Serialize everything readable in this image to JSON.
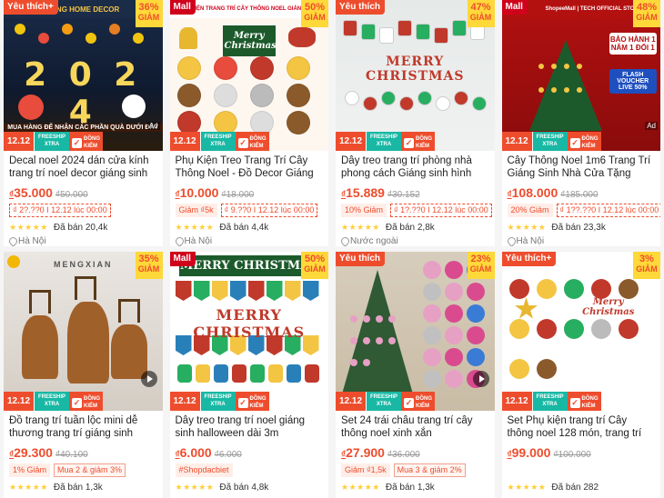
{
  "common": {
    "promo_date": "12.12",
    "free_ship_top": "FREESHIP",
    "free_ship_bottom": "XTRA",
    "guarantee_top": "ĐỒNG",
    "guarantee_bottom": "KIỂM",
    "discount_word": "GIẢM",
    "currency": "₫",
    "ad": "Ad",
    "stars": "★★★★★"
  },
  "products": [
    {
      "label": "Yêu thích+",
      "label_type": "fav",
      "discount": "36%",
      "shop_banner": "TUNG HOME DECOR",
      "thumb_text": "2 0 2 4",
      "thumb_sub": "MUA HÀNG ĐỂ NHẬN CÁC PHẦN QUÀ DƯỚI ĐÂY",
      "title": "Decal noel 2024 dán cửa kính trang trí noel decor giáng sinh ...",
      "price": "35.000",
      "original_price": "₫50.000",
      "tags": [
        "₫ 2?.??0 I 12.12 lúc 00:00"
      ],
      "sold": "Đã bán 20,4k",
      "location": "Hà Nội",
      "has_ad": true,
      "has_play": false
    },
    {
      "label": "Mall",
      "label_type": "mall",
      "discount": "50%",
      "shop_banner": "PHỤ KIỆN TRANG TRÍ CÂY THÔNG NOEL GIÁNG SINH",
      "thumb_text": "Merry Christmas",
      "thumb_sub": "",
      "title": "Phụ Kiện Treo Trang Trí Cây Thông Noel - Đồ Decor Giáng ...",
      "price": "10.000",
      "original_price": "₫18.000",
      "tags": [
        "Giảm ₫5k",
        "₫ 9.??0 I 12.12 lúc 00:00"
      ],
      "sold": "Đã bán 4,4k",
      "location": "Hà Nội",
      "has_ad": false,
      "has_play": false
    },
    {
      "label": "Yêu thích",
      "label_type": "fav",
      "discount": "47%",
      "shop_banner": "",
      "thumb_text": "MERRY CHRISTMAS",
      "thumb_sub": "",
      "title": "Dây treo trang trí phòng nhà phong cách Giáng sinh hình ôn...",
      "price": "15.889",
      "original_price": "₫30.152",
      "tags": [
        "10% Giảm",
        "₫ 1?.??0 I 12.12 lúc 00:00"
      ],
      "sold": "Đã bán 2,8k",
      "location": "Nước ngoài",
      "has_ad": false,
      "has_play": false
    },
    {
      "label": "Mall",
      "label_type": "mall",
      "discount": "48%",
      "shop_banner": "ShopeeMall | TECH OFFICIAL STORE",
      "thumb_text": "BẢO HÀNH 1 NĂM 1 ĐỔI 1",
      "thumb_sub": "FLASH VOUCHER LIVE 50%",
      "title": "Cây Thông Noel 1m6 Trang Trí Giáng Sinh Nhà Cửa Tặng Kèm ...",
      "price": "108.000",
      "original_price": "₫185.000",
      "tags": [
        "20% Giảm",
        "₫ 1??.??0 I 12.12 lúc 00:00"
      ],
      "sold": "Đã bán 23,3k",
      "location": "Hà Nội",
      "has_ad": true,
      "has_play": false
    },
    {
      "label": "",
      "label_type": "",
      "discount": "35%",
      "shop_banner": "MENGXIAN",
      "thumb_text": "",
      "thumb_sub": "",
      "title": "Đồ trang trí tuần lộc mini dễ thương trang trí giáng sinh sán...",
      "price": "29.300",
      "original_price": "₫40.100",
      "tags": [
        "1% Giảm",
        "Mua 2 & giảm 3%"
      ],
      "sold": "Đã bán 1,3k",
      "location": "",
      "has_ad": false,
      "has_play": true
    },
    {
      "label": "Mall",
      "label_type": "mall",
      "discount": "50%",
      "shop_banner": "",
      "thumb_text": "MERRY CHRISTMAS",
      "thumb_sub": "",
      "title": "Dây treo trang trí noel giáng sinh halloween dài 3m",
      "price": "6.000",
      "original_price": "₫6.000",
      "tags": [
        "#Shopdacbiet"
      ],
      "sold": "Đã bán 4,8k",
      "location": "",
      "has_ad": false,
      "has_play": false
    },
    {
      "label": "Yêu thích",
      "label_type": "fav",
      "discount": "23%",
      "shop_banner": "",
      "thumb_text": "",
      "thumb_sub": "",
      "title": "Set 24 trái châu trang trí cây thông noel xinh xắn",
      "price": "27.900",
      "original_price": "₫36.000",
      "tags": [
        "Giảm ₫1,5k",
        "Mua 3 & giảm 2%"
      ],
      "sold": "Đã bán 1,3k",
      "location": "",
      "has_ad": false,
      "has_play": true
    },
    {
      "label": "Yêu thích+",
      "label_type": "fav",
      "discount": "3%",
      "shop_banner": "",
      "thumb_text": "Merry Christmas",
      "thumb_sub": "",
      "title": "Set Phụ kiện trang trí Cây thông noel 128 món, trang trí giáng ...",
      "price": "99.000",
      "original_price": "₫100.000",
      "tags": [],
      "sold": "Đã bán 282",
      "location": "",
      "has_ad": false,
      "has_play": false
    }
  ]
}
